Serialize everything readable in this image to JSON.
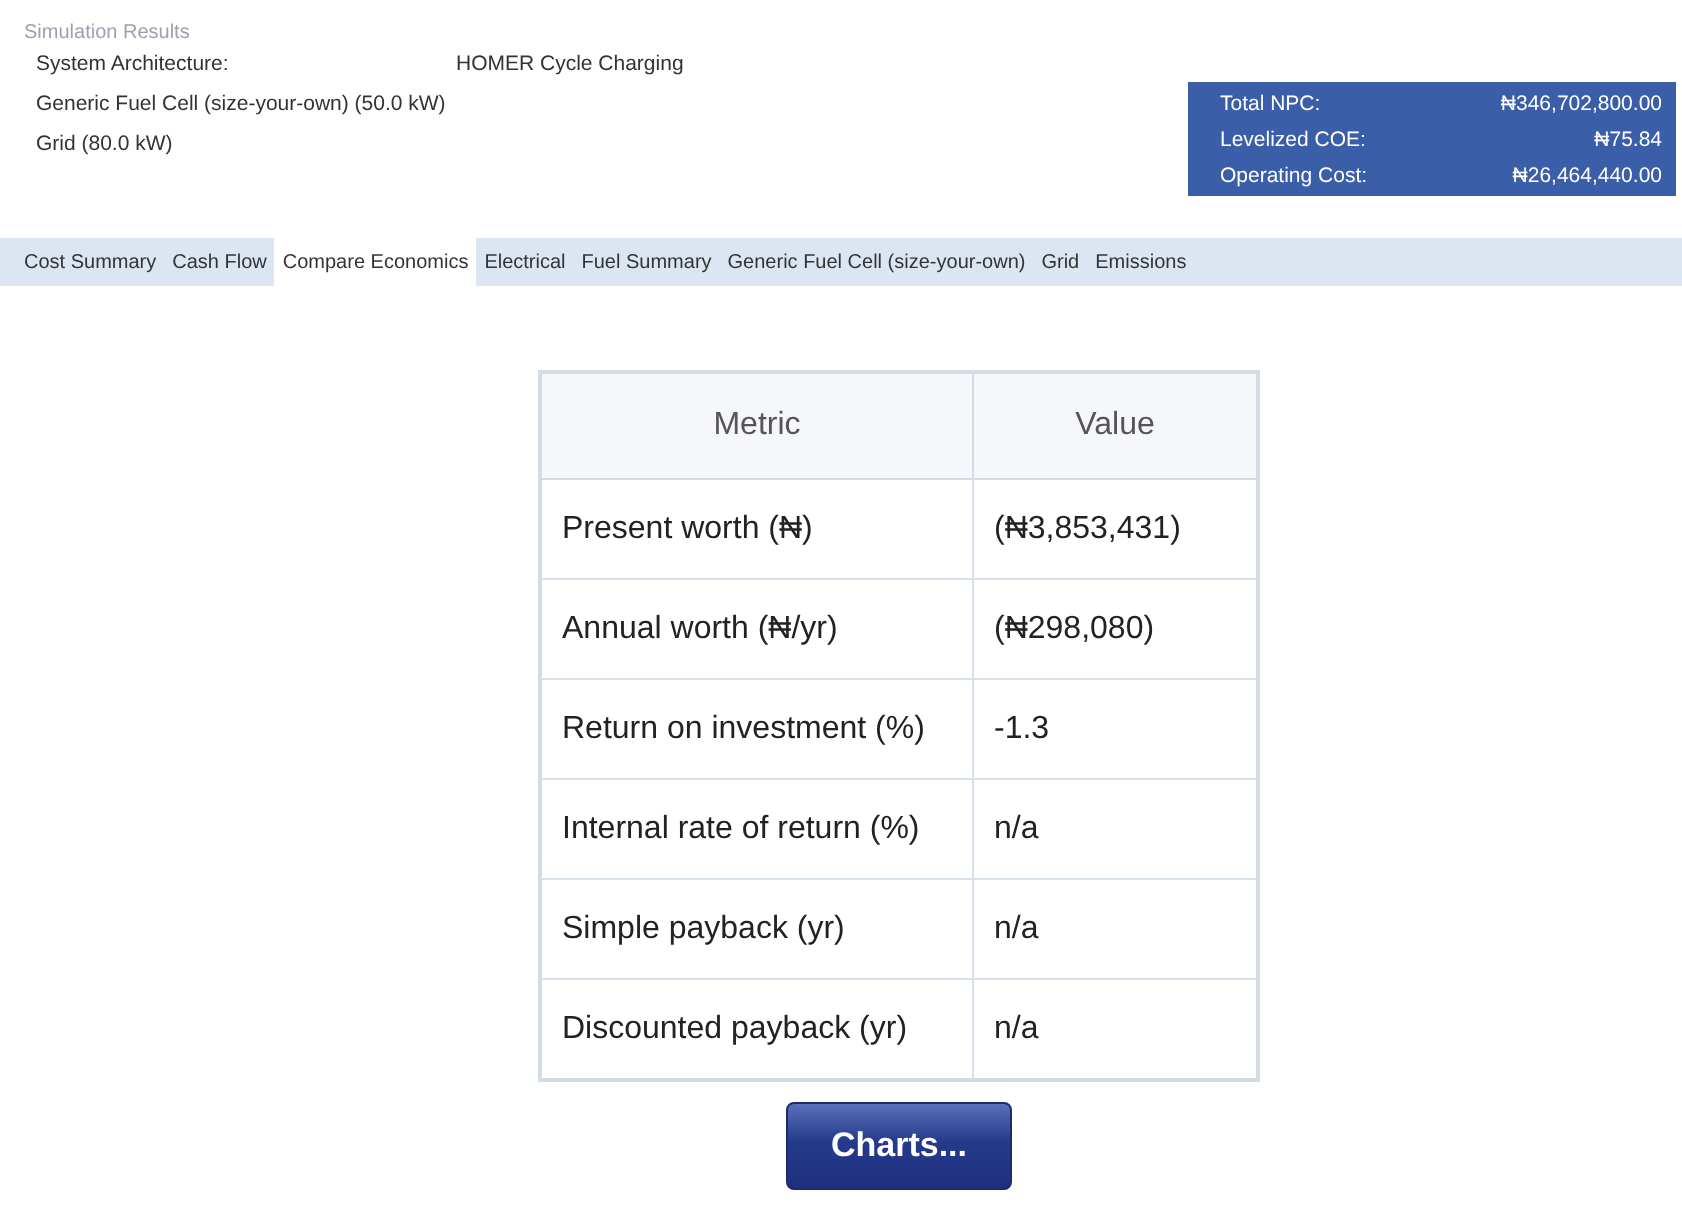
{
  "window": {
    "title": "Simulation Results"
  },
  "architecture": {
    "label": "System Architecture:",
    "dispatch": "HOMER Cycle Charging",
    "components": [
      "Generic Fuel Cell (size-your-own) (50.0 kW)",
      "Grid (80.0 kW)"
    ]
  },
  "summary": [
    {
      "label": "Total NPC:",
      "value": "₦346,702,800.00"
    },
    {
      "label": "Levelized COE:",
      "value": "₦75.84"
    },
    {
      "label": "Operating Cost:",
      "value": "₦26,464,440.00"
    }
  ],
  "tabs": [
    {
      "label": "Cost Summary",
      "selected": false
    },
    {
      "label": "Cash Flow",
      "selected": false
    },
    {
      "label": "Compare Economics",
      "selected": true
    },
    {
      "label": "Electrical",
      "selected": false
    },
    {
      "label": "Fuel Summary",
      "selected": false
    },
    {
      "label": "Generic Fuel Cell (size-your-own)",
      "selected": false
    },
    {
      "label": "Grid",
      "selected": false
    },
    {
      "label": "Emissions",
      "selected": false
    }
  ],
  "table": {
    "columns": [
      "Metric",
      "Value"
    ],
    "rows": [
      [
        "Present worth (₦)",
        "(₦3,853,431)"
      ],
      [
        "Annual worth (₦/yr)",
        "(₦298,080)"
      ],
      [
        "Return on investment (%)",
        "-1.3"
      ],
      [
        "Internal rate of return (%)",
        "n/a"
      ],
      [
        "Simple payback (yr)",
        "n/a"
      ],
      [
        "Discounted payback (yr)",
        "n/a"
      ]
    ]
  },
  "charts_button": "Charts..."
}
